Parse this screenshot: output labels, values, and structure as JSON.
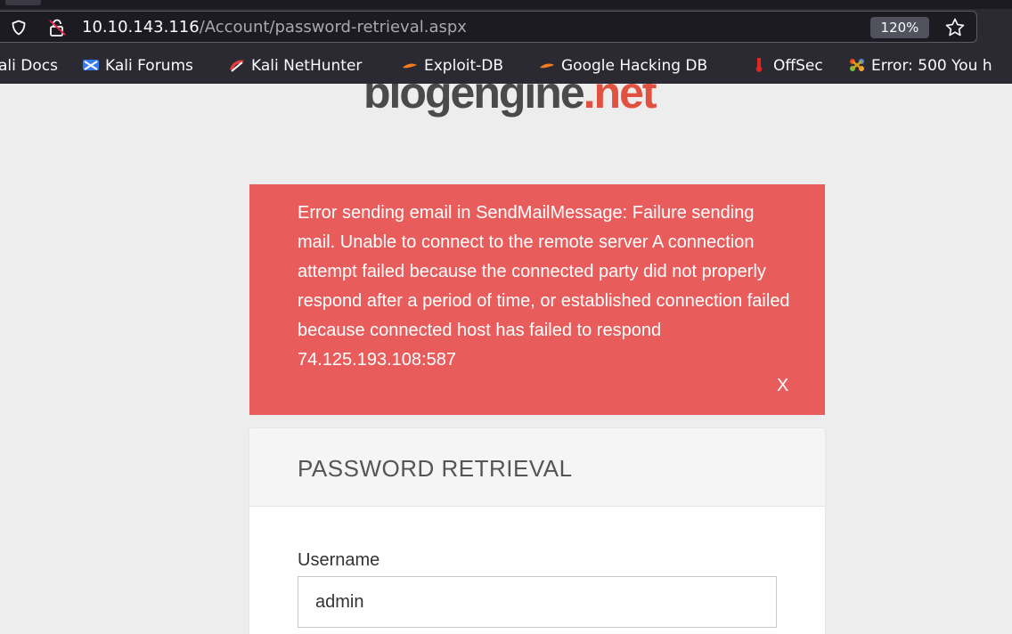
{
  "browser": {
    "url_host": "10.10.143.116",
    "url_path": "/Account/password-retrieval.aspx",
    "zoom": "120%",
    "bookmarks": [
      {
        "label": "ali Docs",
        "icon": "kali-docs-icon"
      },
      {
        "label": "Kali Forums",
        "icon": "kali-forums-icon"
      },
      {
        "label": "Kali NetHunter",
        "icon": "nethunter-icon"
      },
      {
        "label": "Exploit-DB",
        "icon": "exploit-db-icon"
      },
      {
        "label": "Google Hacking DB",
        "icon": "ghdb-icon"
      },
      {
        "label": "OffSec",
        "icon": "offsec-icon"
      },
      {
        "label": "Error: 500 You h",
        "icon": "joomla-icon"
      }
    ]
  },
  "logo": {
    "part1": "blogengine",
    "part2": ".net"
  },
  "alert": {
    "message": "Error sending email in SendMailMessage: Failure sending mail. Unable to connect to the remote server A connection attempt failed because the connected party did not properly respond after a period of time, or established connection failed because connected host has failed to respond 74.125.193.108:587",
    "close_label": "X",
    "color": "#e85c5c"
  },
  "form": {
    "title": "PASSWORD RETRIEVAL",
    "username_label": "Username",
    "username_value": "admin"
  }
}
